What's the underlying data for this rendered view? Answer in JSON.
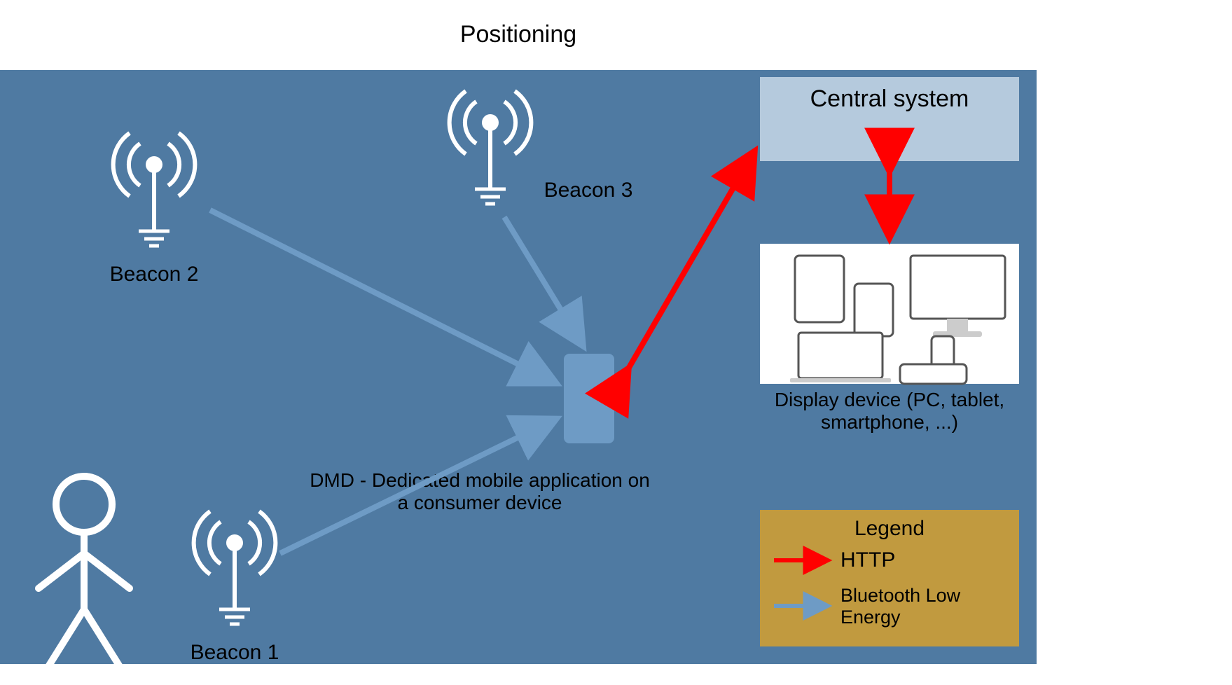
{
  "title": "Positioning",
  "nodes": {
    "beacon1": "Beacon 1",
    "beacon2": "Beacon 2",
    "beacon3": "Beacon 3",
    "mobile": "DMD - Dedicated mobile application on a consumer device",
    "central": "Central system",
    "display": "Display device (PC, tablet, smartphone, ...)"
  },
  "legend": {
    "heading": "Legend",
    "http": "HTTP",
    "ble": "Bluetooth Low Energy"
  },
  "colors": {
    "bg": "#4F7AA2",
    "light": "#B5CADD",
    "http": "#FF0000",
    "ble": "#6E9BC5",
    "legendbg": "#C19A3F"
  }
}
